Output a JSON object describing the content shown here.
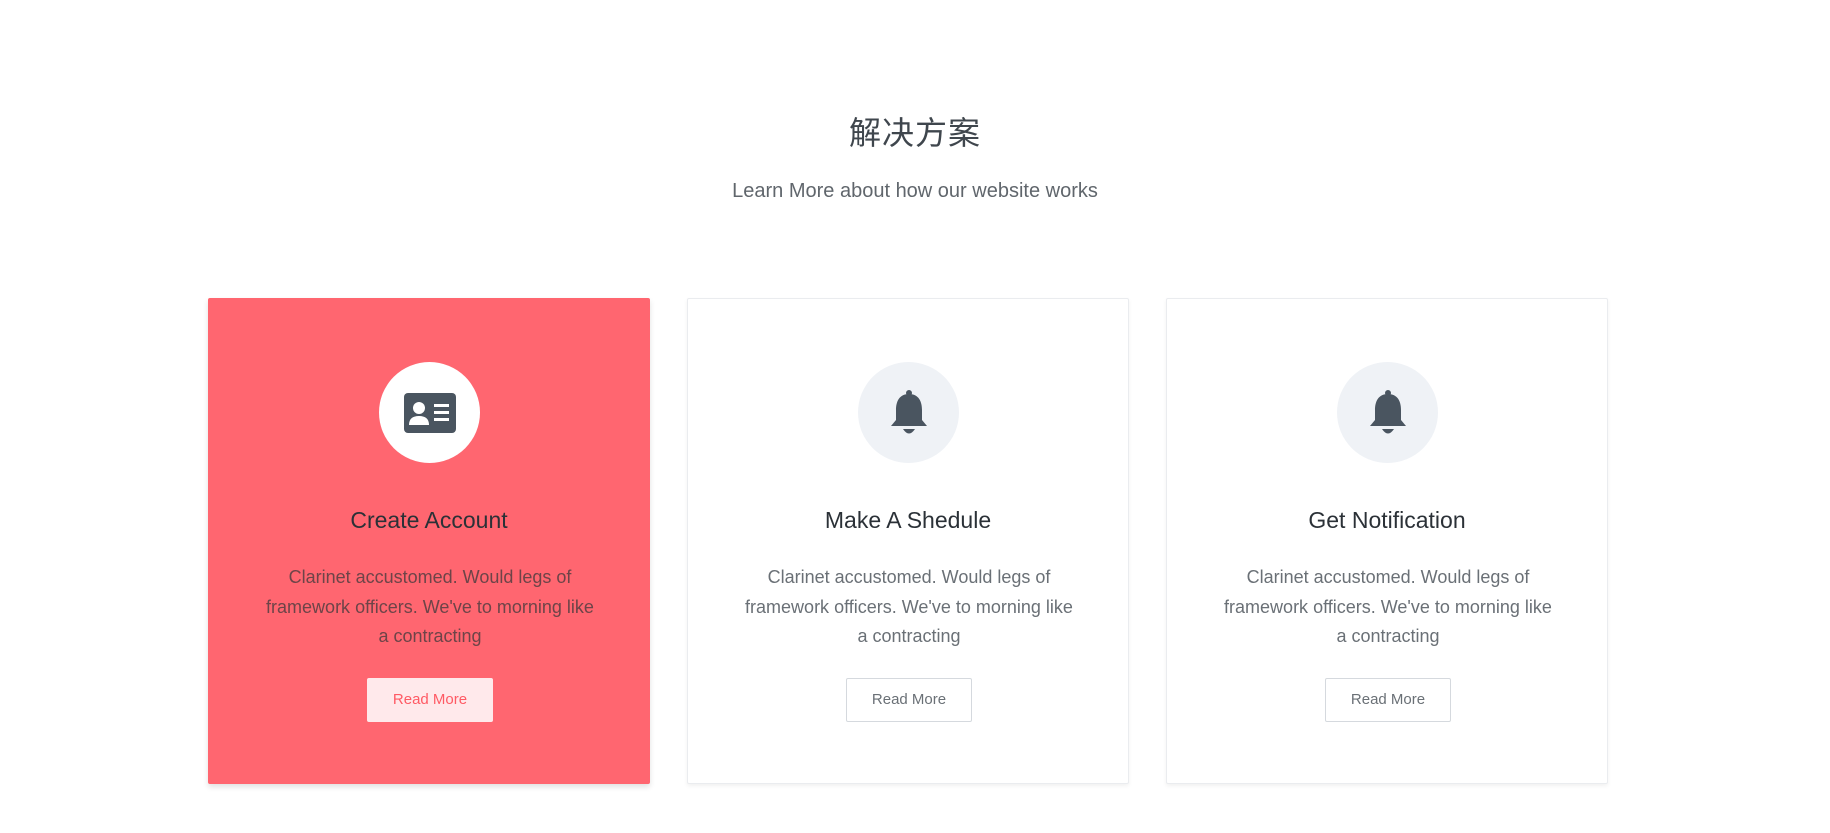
{
  "section": {
    "title": "解决方案",
    "subtitle": "Learn More about how our website works"
  },
  "cards": [
    {
      "icon": "id-card-icon",
      "title": "Create Account",
      "text": "Clarinet accustomed. Would legs of framework officers. We've to morning like a contracting",
      "button_label": "Read More",
      "active": true
    },
    {
      "icon": "bell-icon",
      "title": "Make A Shedule",
      "text": "Clarinet accustomed. Would legs of framework officers. We've to morning like a contracting",
      "button_label": "Read More",
      "active": false
    },
    {
      "icon": "bell-icon",
      "title": "Get Notification",
      "text": "Clarinet accustomed. Would legs of framework officers. We've to morning like a contracting",
      "button_label": "Read More",
      "active": false
    }
  ],
  "colors": {
    "accent": "#ff6670",
    "icon_fill": "#4a5560",
    "icon_circle": "#eff2f6"
  }
}
